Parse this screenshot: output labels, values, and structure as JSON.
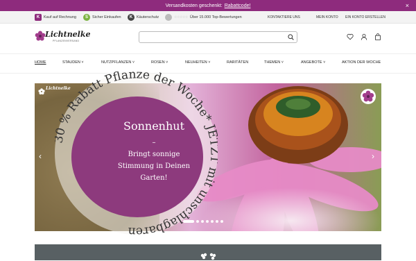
{
  "promo": {
    "text": "Versandkosten geschenkt:",
    "link": "Rabattcode!",
    "close": "×"
  },
  "trust": {
    "items": [
      {
        "icon": "K",
        "label": "Kauf auf Rechnung"
      },
      {
        "icon": "S",
        "label": "Sicher Einkaufen"
      },
      {
        "icon": "K",
        "label": "Käuterschutz"
      }
    ],
    "rating": {
      "stars": "☆☆☆☆☆",
      "label": "Über 15.000 Top-Bewertungen"
    },
    "links": [
      "KONTAKTIERE UNS",
      "MEIN KONTO",
      "EIN KONTO ERSTELLEN"
    ]
  },
  "logo": {
    "name": "Lichtnelke",
    "sub": "PFLANZENVERSAND"
  },
  "search": {
    "placeholder": ""
  },
  "nav": [
    {
      "label": "HOME"
    },
    {
      "label": "STAUDEN ˅"
    },
    {
      "label": "NUTZPFLANZEN ˅"
    },
    {
      "label": "ROSEN ˅"
    },
    {
      "label": "NEUHEITEN ˅"
    },
    {
      "label": "RARITÄTEN"
    },
    {
      "label": "THEMEN ˅"
    },
    {
      "label": "ANGEBOTE ˅"
    },
    {
      "label": "AKTION DER WOCHE"
    }
  ],
  "hero": {
    "logo": "Lichtnelke",
    "ring_text": "30 % Rabatt Pflanze der Woche* JETZT mit unschlagbaren",
    "title": "Sonnenhut",
    "dash": "–",
    "subtitle1": "Bringt sonnige",
    "subtitle2": "Stimmung in Deinen",
    "subtitle3": "Garten!",
    "prev": "‹",
    "next": "›",
    "slides": 7
  },
  "colors": {
    "accent": "#8e2b7d",
    "badge": "#8d3a7d"
  }
}
